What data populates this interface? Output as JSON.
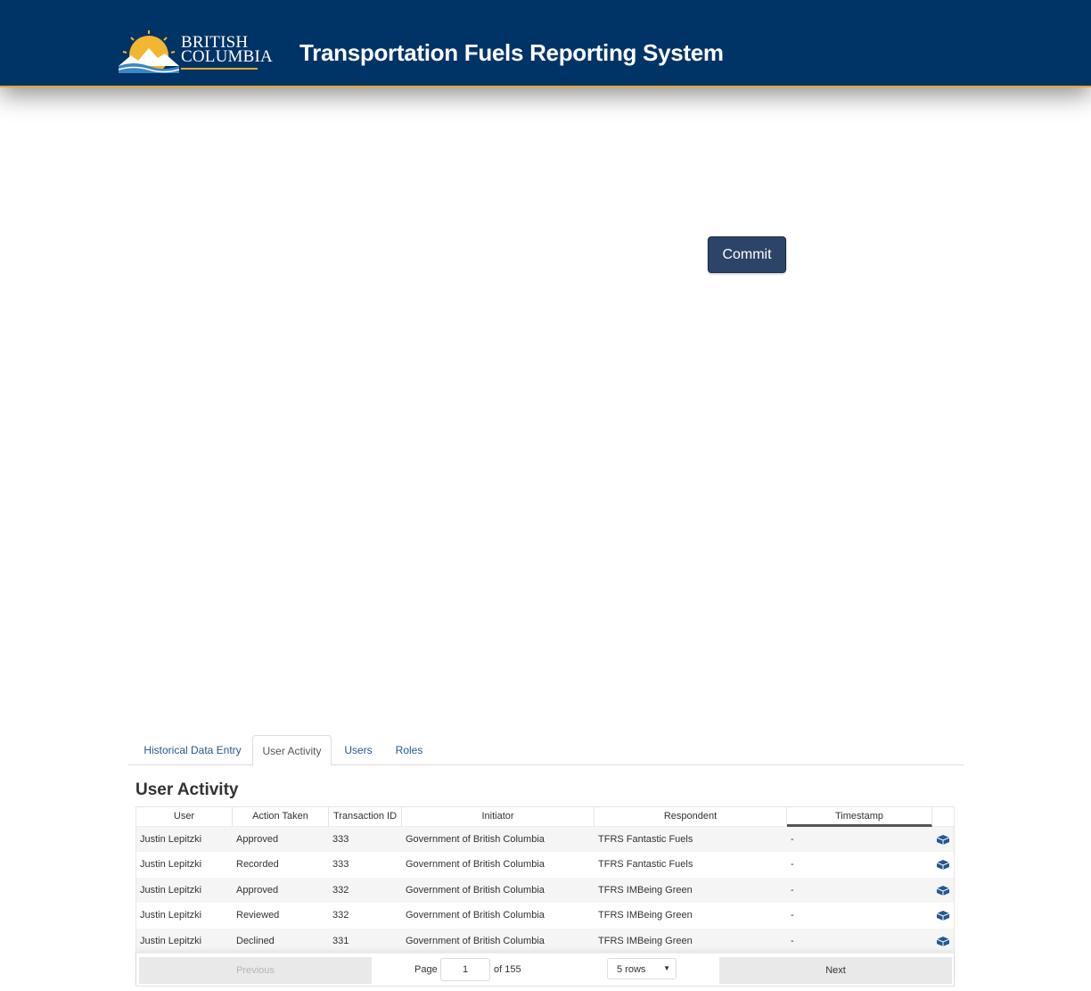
{
  "header": {
    "logo_line1": "BRITISH",
    "logo_line2": "COLUMBIA",
    "app_title": "Transportation Fuels Reporting System"
  },
  "commit_label": "Commit",
  "tabs": [
    {
      "label": "Historical Data Entry",
      "active": false
    },
    {
      "label": "User Activity",
      "active": true
    },
    {
      "label": "Users",
      "active": false
    },
    {
      "label": "Roles",
      "active": false
    }
  ],
  "section_title": "User Activity",
  "table": {
    "columns": [
      "User",
      "Action Taken",
      "Transaction ID",
      "Initiator",
      "Respondent",
      "Timestamp"
    ],
    "rows": [
      [
        "Justin Lepitzki",
        "Approved",
        "333",
        "Government of British Columbia",
        "TFRS Fantastic Fuels",
        "-"
      ],
      [
        "Justin Lepitzki",
        "Recorded",
        "333",
        "Government of British Columbia",
        "TFRS Fantastic Fuels",
        "-"
      ],
      [
        "Justin Lepitzki",
        "Approved",
        "332",
        "Government of British Columbia",
        "TFRS IMBeing Green",
        "-"
      ],
      [
        "Justin Lepitzki",
        "Reviewed",
        "332",
        "Government of British Columbia",
        "TFRS IMBeing Green",
        "-"
      ],
      [
        "Justin Lepitzki",
        "Declined",
        "331",
        "Government of British Columbia",
        "TFRS IMBeing Green",
        "-"
      ]
    ],
    "row_icon": "box-icon"
  },
  "pagination": {
    "previous_label": "Previous",
    "page_label": "Page",
    "page_value": "1",
    "of_label": "of 155",
    "rows_label": "5 rows",
    "next_label": "Next"
  },
  "colors": {
    "header_bg": "#003366",
    "accent_gold": "#e3a82b",
    "button_bg": "#2d4469",
    "link": "#245890"
  }
}
